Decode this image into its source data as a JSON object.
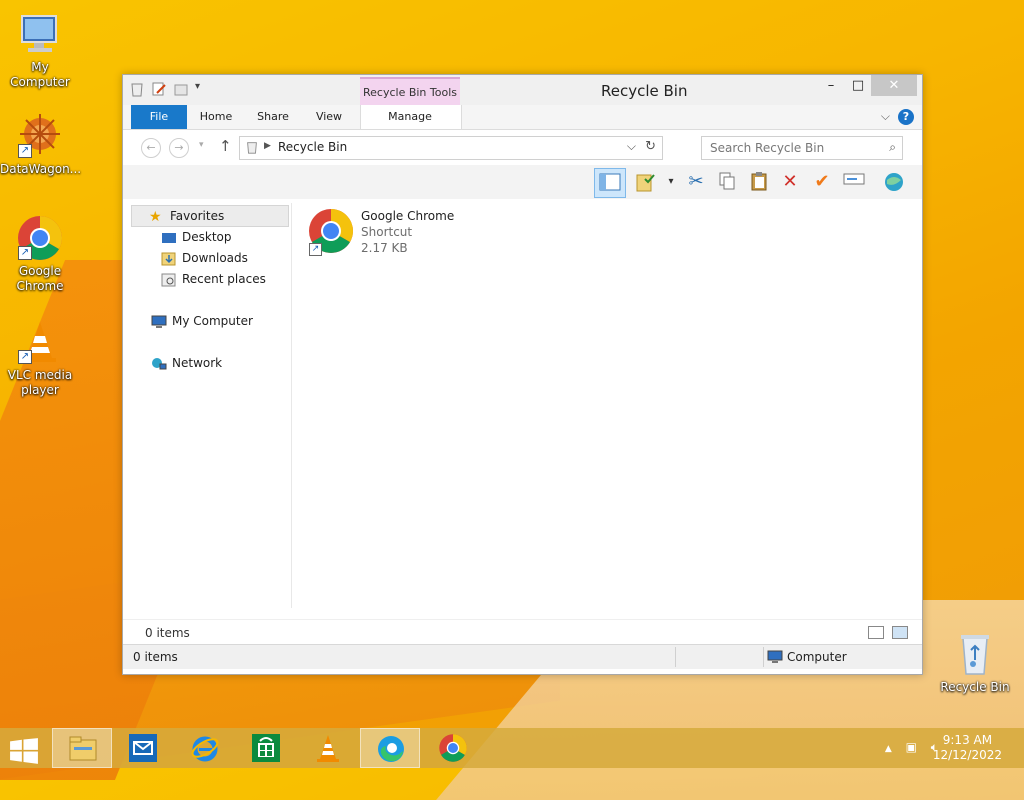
{
  "desktop": {
    "icons": [
      {
        "label": "My Computer"
      },
      {
        "label": "DataWagon..."
      },
      {
        "label": "Google Chrome"
      },
      {
        "label": "VLC media player"
      },
      {
        "label": "Recycle Bin"
      }
    ]
  },
  "window": {
    "title": "Recycle Bin",
    "context_tab": "Recycle Bin Tools",
    "ribbon_tabs": [
      "File",
      "Home",
      "Share",
      "View",
      "Manage"
    ],
    "address": "Recycle Bin",
    "search_placeholder": "Search Recycle Bin",
    "nav": {
      "favorites": "Favorites",
      "desktop": "Desktop",
      "downloads": "Downloads",
      "recent": "Recent places",
      "computer": "My Computer",
      "network": "Network"
    },
    "files": [
      {
        "name": "Google Chrome",
        "type": "Shortcut",
        "size": "2.17 KB"
      }
    ],
    "inner_status": "0 items",
    "status_count": "0 items",
    "status_location": "Computer"
  },
  "taskbar": {
    "time": "9:13 AM",
    "date": "12/12/2022"
  },
  "colors": {
    "accent": "#1979ca",
    "context_tab": "#f3d4ef",
    "desktop": "#f7b500"
  }
}
